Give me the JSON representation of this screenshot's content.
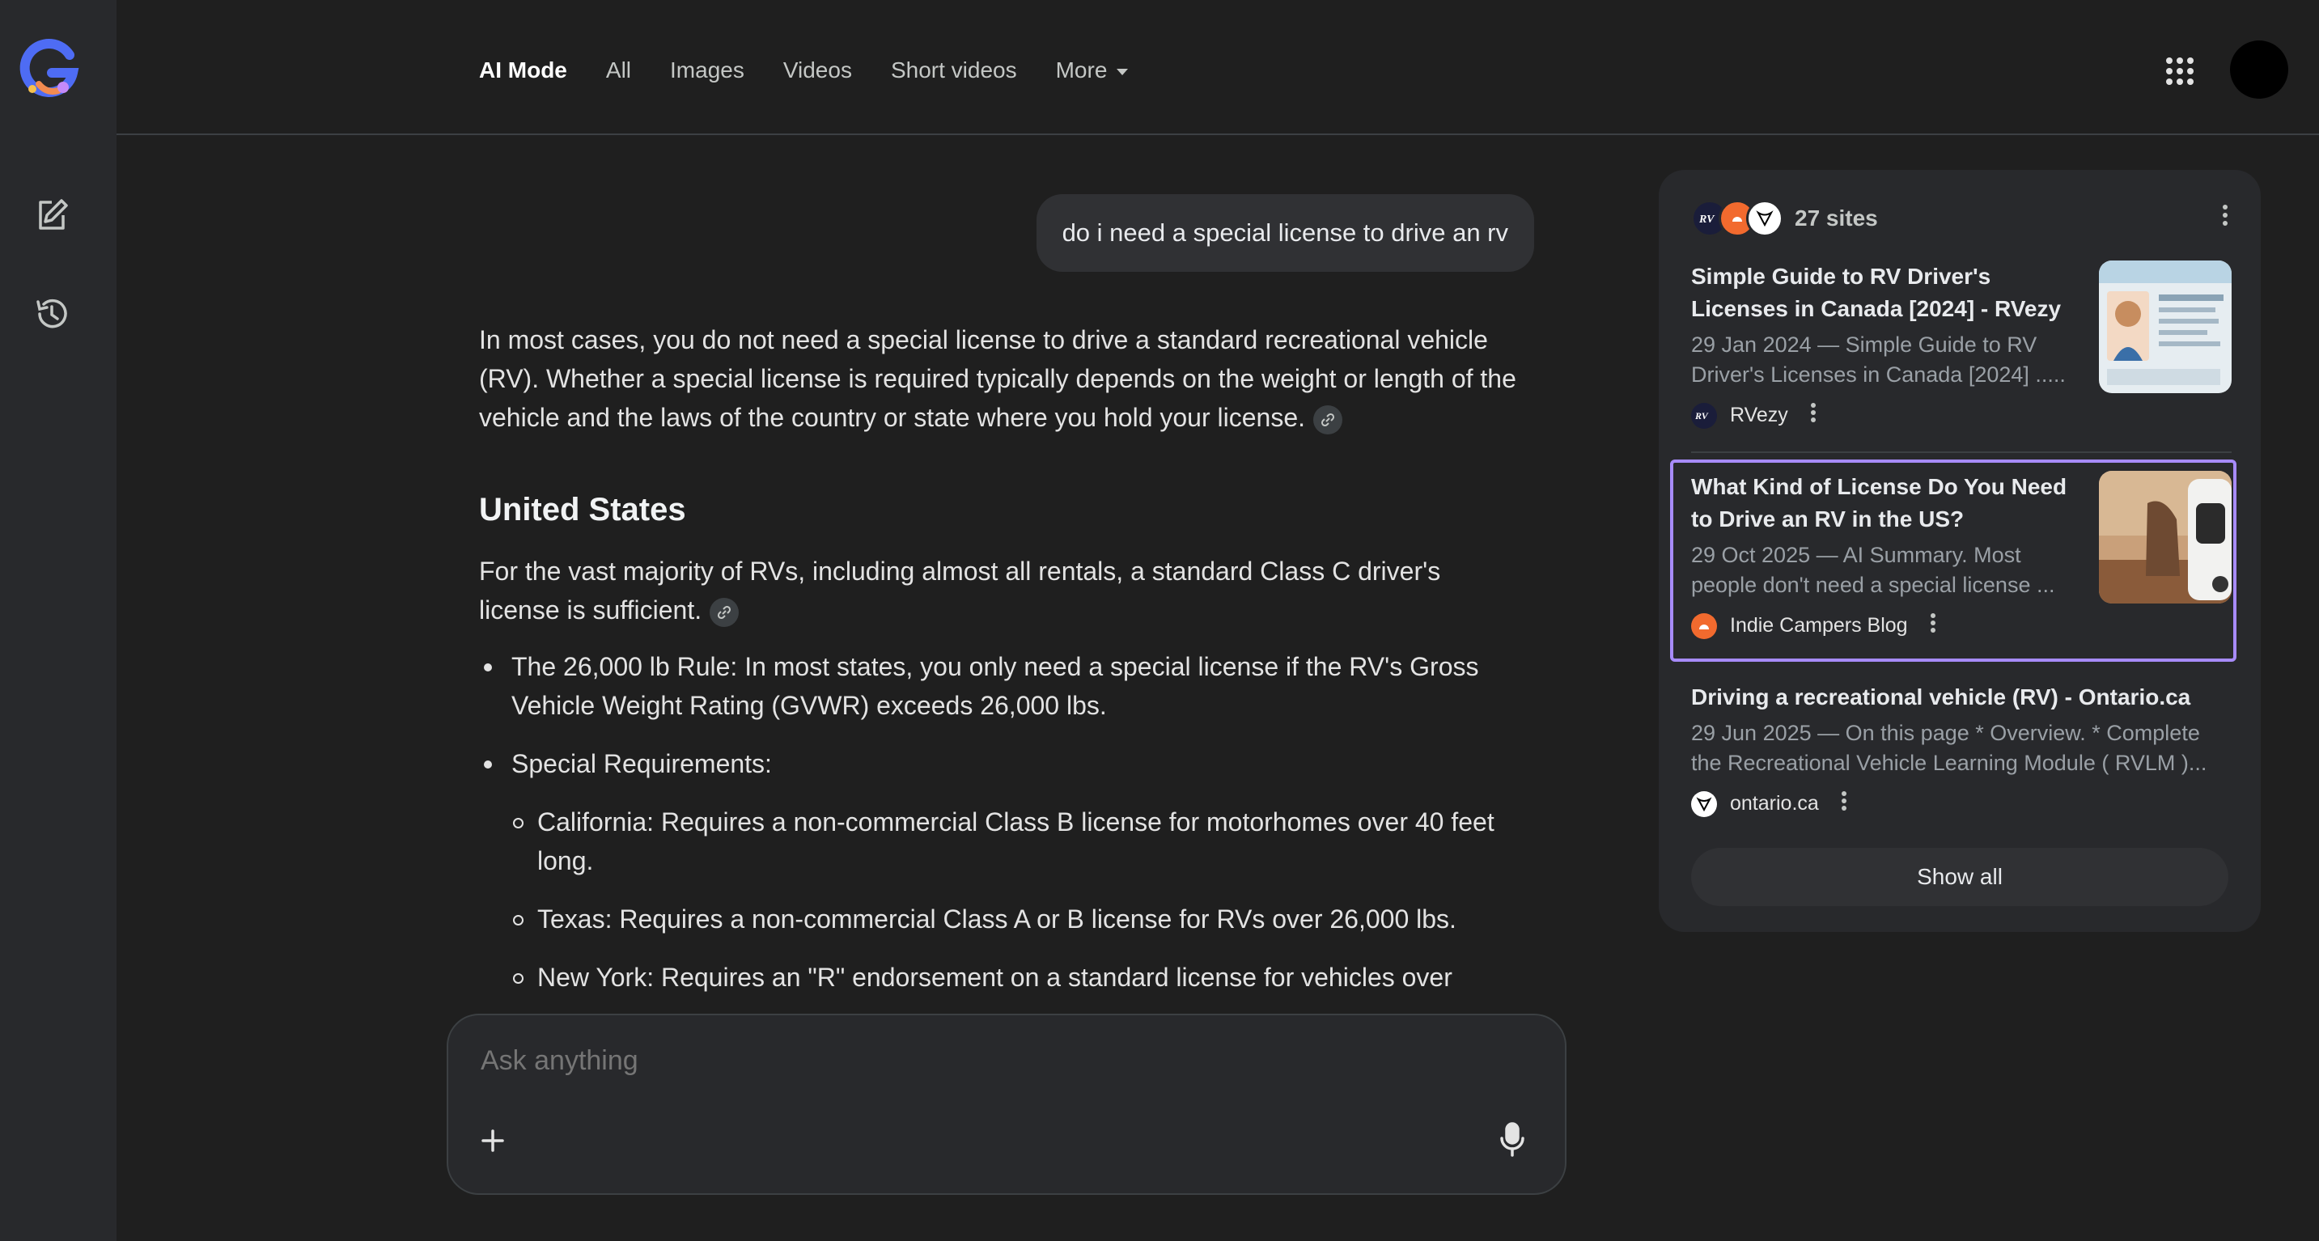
{
  "header": {
    "tabs": [
      {
        "label": "AI Mode",
        "active": true
      },
      {
        "label": "All"
      },
      {
        "label": "Images"
      },
      {
        "label": "Videos"
      },
      {
        "label": "Short videos"
      },
      {
        "label": "More"
      }
    ]
  },
  "rail": {
    "icons": [
      "google-g-logo",
      "new-chat-icon",
      "history-icon"
    ]
  },
  "chat": {
    "user_query": "do i need a special license to drive an rv",
    "intro": "In most cases, you do not need a special license to drive a standard recreational vehicle (RV). Whether a special license is required typically depends on the weight or length of the vehicle and the laws of the country or state where you hold your license.",
    "section_heading": "United States",
    "section_para": "For the vast majority of RVs, including almost all rentals, a standard Class C driver's license is sufficient.",
    "bullets": [
      "The 26,000 lb Rule: In most states, you only need a special license if the RV's Gross Vehicle Weight Rating (GVWR) exceeds 26,000 lbs.",
      "Special Requirements:"
    ],
    "sub_bullets": [
      "California: Requires a non-commercial Class B license for motorhomes over 40 feet long.",
      "Texas: Requires a non-commercial Class A or B license for RVs over 26,000 lbs.",
      "New York: Requires an \"R\" endorsement on a standard license for vehicles over"
    ]
  },
  "ask": {
    "placeholder": "Ask anything"
  },
  "sources": {
    "count_label": "27 sites",
    "items": [
      {
        "title": "Simple Guide to RV Driver's Licenses in Canada [2024] - RVezy",
        "snippet": "29 Jan 2024 — Simple Guide to RV Driver's Licenses in Canada [2024] .....",
        "site": "RVezy"
      },
      {
        "title": "What Kind of License Do You Need to Drive an RV in the US?",
        "snippet": "29 Oct 2025 — AI Summary. Most people don't need a special license ...",
        "site": "Indie Campers Blog"
      },
      {
        "title": "Driving a recreational vehicle (RV) - Ontario.ca",
        "snippet": "29 Jun 2025 — On this page * Overview. * Complete the Recreational Vehicle Learning Module ( RVLM )...",
        "site": "ontario.ca"
      }
    ],
    "show_all_label": "Show all"
  },
  "colors": {
    "background": "#1f1f1f",
    "panel": "#28292c",
    "highlight": "#a78bfa",
    "indie_orange": "#f26a2e"
  }
}
